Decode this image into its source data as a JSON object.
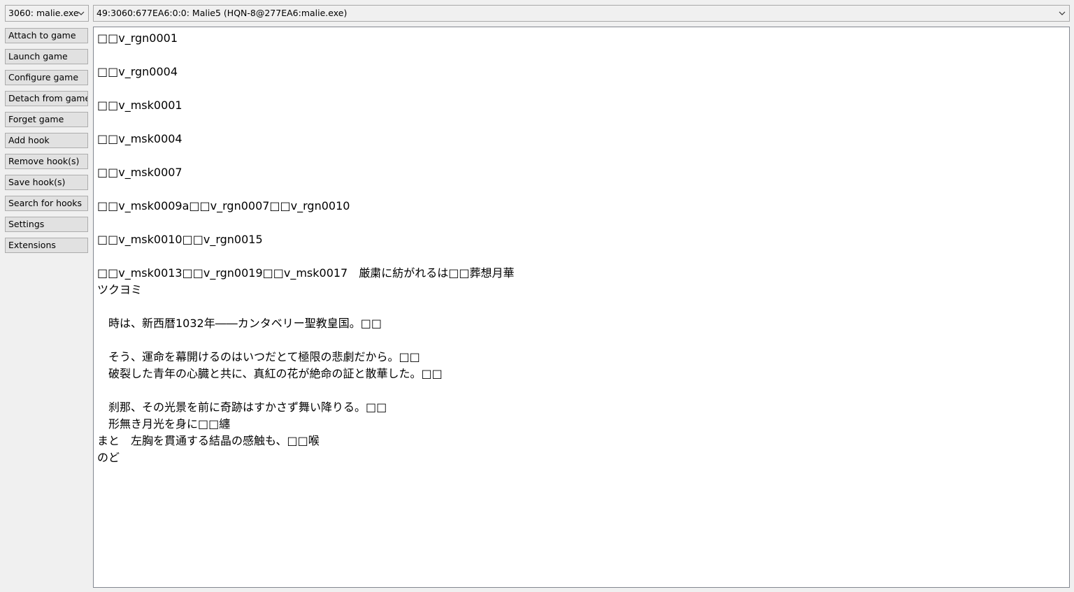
{
  "process_select": {
    "value": "3060: malie.exe"
  },
  "hook_select": {
    "value": "49:3060:677EA6:0:0: Malie5 (HQN-8@277EA6:malie.exe)"
  },
  "buttons": [
    {
      "name": "attach-to-game-button",
      "label": "Attach to game"
    },
    {
      "name": "launch-game-button",
      "label": "Launch game"
    },
    {
      "name": "configure-game-button",
      "label": "Configure game"
    },
    {
      "name": "detach-from-game-button",
      "label": "Detach from game"
    },
    {
      "name": "forget-game-button",
      "label": "Forget game"
    },
    {
      "name": "add-hook-button",
      "label": "Add hook"
    },
    {
      "name": "remove-hooks-button",
      "label": "Remove hook(s)"
    },
    {
      "name": "save-hooks-button",
      "label": "Save hook(s)"
    },
    {
      "name": "search-for-hooks-button",
      "label": "Search for hooks"
    },
    {
      "name": "settings-button",
      "label": "Settings"
    },
    {
      "name": "extensions-button",
      "label": "Extensions"
    }
  ],
  "text_lines": [
    "□□v_rgn0001",
    "",
    "□□v_rgn0004",
    "",
    "□□v_msk0001",
    "",
    "□□v_msk0004",
    "",
    "□□v_msk0007",
    "",
    "□□v_msk0009a□□v_rgn0007□□v_rgn0010",
    "",
    "□□v_msk0010□□v_rgn0015",
    "",
    "□□v_msk0013□□v_rgn0019□□v_msk0017　厳粛に紡がれるは□□葬想月華",
    "ツクヨミ",
    "",
    "　時は、新西暦1032年――カンタベリー聖教皇国。□□",
    "",
    "　そう、運命を幕開けるのはいつだとて極限の悲劇だから。□□",
    "　破裂した青年の心臓と共に、真紅の花が絶命の証と散華した。□□",
    "",
    "　刹那、その光景を前に奇跡はすかさず舞い降りる。□□",
    "　形無き月光を身に□□纏",
    "まと　左胸を貫通する結晶の感触も、□□喉",
    "のど"
  ]
}
